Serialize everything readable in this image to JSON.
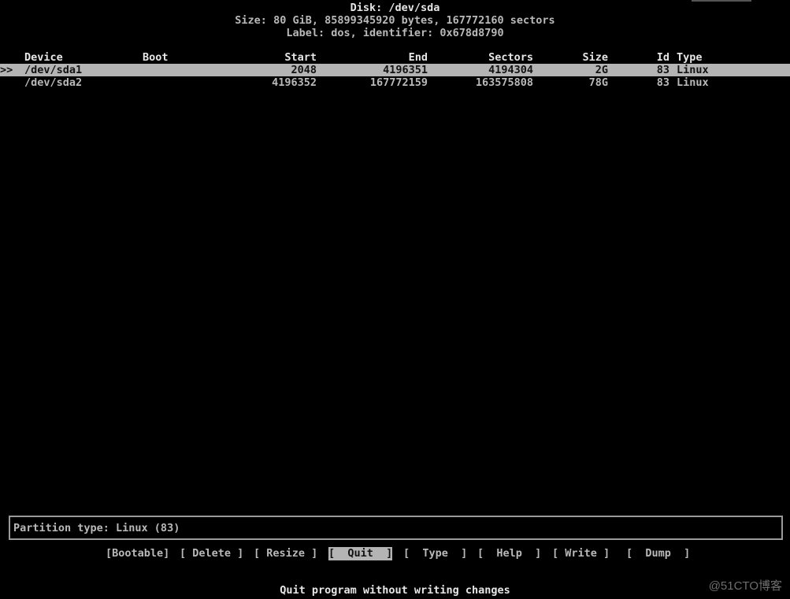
{
  "disk": {
    "title": "Disk: /dev/sda",
    "size_info": "Size: 80 GiB, 85899345920 bytes, 167772160 sectors",
    "label_info": "Label: dos, identifier: 0x678d8790"
  },
  "table": {
    "headers": {
      "device": "Device",
      "boot": "Boot",
      "start": "Start",
      "end": "End",
      "sectors": "Sectors",
      "size": "Size",
      "id": "Id",
      "type": "Type"
    },
    "selection_marker": ">>",
    "rows": [
      {
        "device": "/dev/sda1",
        "boot": "",
        "start": "2048",
        "end": "4196351",
        "sectors": "4194304",
        "size": "2G",
        "id": "83",
        "type": "Linux",
        "selected": true
      },
      {
        "device": "/dev/sda2",
        "boot": "",
        "start": "4196352",
        "end": "167772159",
        "sectors": "163575808",
        "size": "78G",
        "id": "83",
        "type": "Linux",
        "selected": false
      }
    ]
  },
  "status": {
    "text": "Partition type: Linux (83)"
  },
  "menu": {
    "items": [
      {
        "label": "[Bootable]"
      },
      {
        "label": "[ Delete ]"
      },
      {
        "label": "[ Resize ]"
      },
      {
        "label": "[  Quit  ]",
        "active": true
      },
      {
        "label": "[  Type  ]"
      },
      {
        "label": "[  Help  ]"
      },
      {
        "label": "[ Write ]"
      },
      {
        "label": "[  Dump  ]"
      }
    ]
  },
  "hint": "Quit program without writing changes",
  "watermark": "@51CTO博客",
  "colors": {
    "background": "#000000",
    "text": "#b9b9b9",
    "bright_text": "#e6e6e6",
    "highlight_bg": "#b4b4b4",
    "highlight_fg": "#111111"
  }
}
